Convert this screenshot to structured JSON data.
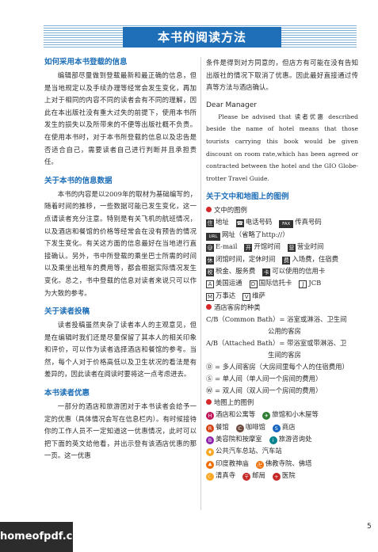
{
  "title": "本书的阅读方法",
  "left": {
    "s1_head": "如何采用本书登载的信息",
    "s1_body": "编辑部尽量做到登载最新和最正确的信息，但是当地规定以及手续办理等经常会发生变化，再加上对于相同的内容不同的读者会有不同的理解，因此在本出版社没有重大过失的前提下，使用本书所发生的损失以及所带来的不便等出版社概不负责。在使用本书时，对于本书所登载的信息以及忠告是否适合自己，需要读者自己进行判断并且承担责任。",
    "s2_head": "关于本书的信息数据",
    "s2_body": "本书的内容是以2009年的取材为基础编写的，随着时间的推移，一些数据可能已发生变化，这一点请读者充分注意。特别是有关飞机的航班情况，以及酒店和餐馆的价格等经常会在没有预告的情况下发生变化。有关这方面的信息最好在当地进行直接确认。另外，书中所登载的乘坐巴士所需的时间以及乘坐出租车的费用等，都会根据实际情况发生变化。总之，书中登载的信息对读者来说只可以作为大致的参考。",
    "s3_head": "关于读者投稿",
    "s3_body": "读者投稿虽然夹杂了读者本人的主观意见，但是在编辑时我们还是尽量保留了其本人的相关印象和评价，可以作为读者选择酒店和餐馆的参考。当然，每个人对于价格高低以及卫生状况的看法是有差异的，因此读者在阅读时要将这一点考虑进去。",
    "s4_head": "本书读者优惠",
    "s4_body": "一部分的酒店和旅游团对于本书读者会给予一定的优惠（具体情况会写在信息栏内）。有时候接待你的工作人员不一定知道这一优惠情况，此时可以把下面的英文给他看，并出示登有该酒店优惠的那一页。这一优惠"
  },
  "right": {
    "cont": "条件是得到对方同意的，但店方有可能在没有告知出版社的情况下取消了优惠。因此最好直接通过传真等方法与酒店确认。",
    "en_head": "Dear Manager",
    "en_body": "Please be advised that 读者优惠 described beside the name of hotel means that those tourists carrying this book would be given discount on room rate,which has been agreed or contracted between the hotel and the GIO Globe-trotter Travel Guide.",
    "s5_head": "关于文中和地图上的图例",
    "legend_text_head": "文中的图例",
    "legend_rows": [
      [
        {
          "i": "住",
          "t": "地址"
        },
        {
          "i": "☎",
          "t": "电话号码"
        },
        {
          "i": "FAX",
          "t": "传真号码"
        }
      ],
      [
        {
          "i": "URL",
          "t": "网址（省略了http://）"
        }
      ],
      [
        {
          "i": "@",
          "t": "E-mail"
        },
        {
          "i": "开",
          "t": "开馆时间"
        },
        {
          "i": "营",
          "t": "营业时间"
        }
      ],
      [
        {
          "i": "休",
          "t": "闭馆时间，定休时间"
        },
        {
          "i": "费",
          "t": "入场费，住宿费"
        }
      ],
      [
        {
          "i": "税",
          "t": "税金、服务费"
        },
        {
          "i": "卡",
          "t": "可以使用的信用卡"
        }
      ],
      [
        {
          "i": "A",
          "t": "美国运通"
        },
        {
          "i": "D",
          "t": "国际信托卡"
        },
        {
          "i": "J",
          "t": "JCB"
        }
      ],
      [
        {
          "i": "M",
          "t": "万事达"
        },
        {
          "i": "V",
          "t": "维萨"
        }
      ]
    ],
    "legend_room_head": "酒店客房的种类",
    "room1_a": "C/B（Common Bath）= 浴室或淋浴、卫生间",
    "room1_b": "公用的客房",
    "room2_a": "A/B（Attached Bath）= 带浴室或带淋浴、卫",
    "room2_b": "生间的客房",
    "room3": "Ⓓ = 多人间客房（大房间里每个人的住宿费用）",
    "room4": "Ⓢ = 单人间（单人间一个房间的费用）",
    "room5": "Ⓦ = 双人间（双人间一个房间的费用）",
    "legend_map_head": "地图上的图例",
    "map_rows": [
      [
        {
          "i": "H",
          "c": "#c2185b",
          "t": "酒店和公寓等"
        },
        {
          "i": "✈",
          "c": "#2e7d32",
          "t": "旅馆和小木屋等"
        }
      ],
      [
        {
          "i": "R",
          "c": "#d84315",
          "t": "餐馆"
        },
        {
          "i": "C",
          "c": "#6d4c41",
          "t": "咖啡馆"
        },
        {
          "i": "S",
          "c": "#1565c0",
          "t": "商店"
        }
      ],
      [
        {
          "i": "B",
          "c": "#8e24aa",
          "t": "美容院和按摩室"
        },
        {
          "i": "i",
          "c": "#00838f",
          "t": "旅游咨询处"
        }
      ],
      [
        {
          "i": "♦",
          "c": "#f9a825",
          "t": "公共汽车总站、汽车站"
        }
      ],
      [
        {
          "i": "♣",
          "c": "#ef6c00",
          "t": "印度教神庙"
        },
        {
          "i": "卍",
          "c": "#ef6c00",
          "t": "佛教寺院、佛塔"
        }
      ],
      [
        {
          "i": "☾",
          "c": "#f9a825",
          "t": "清真寺"
        },
        {
          "i": "〒",
          "c": "#c62828",
          "t": "邮局"
        },
        {
          "i": "+",
          "c": "#c62828",
          "t": "医院"
        }
      ]
    ]
  },
  "watermark": "homeofpdf.com",
  "page_number": "5"
}
